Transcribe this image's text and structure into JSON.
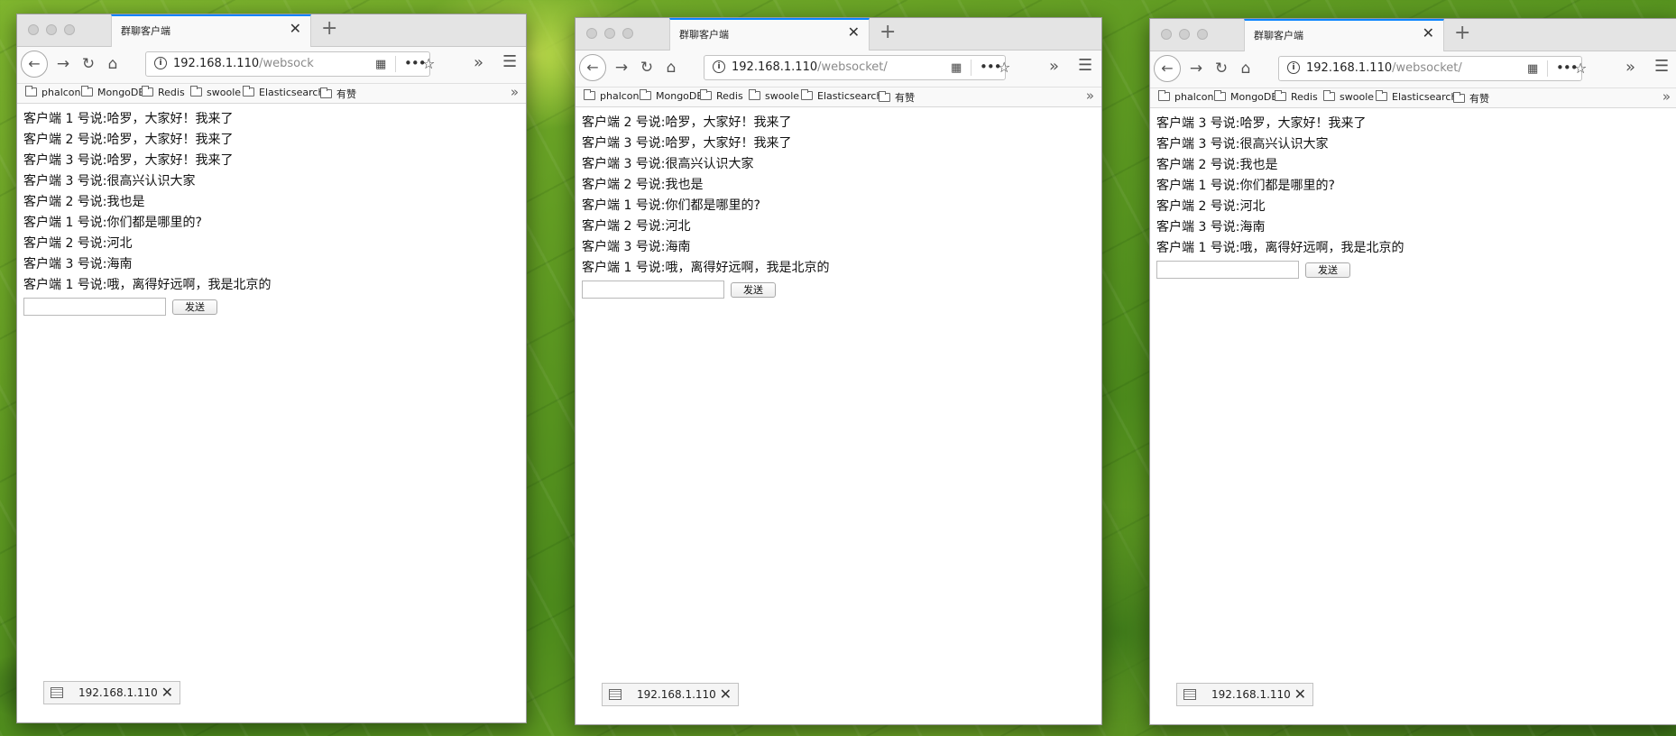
{
  "windows": [
    {
      "tab_title": "群聊客户端",
      "url_main": "192.168.1.110",
      "url_rest": "/websock",
      "bookmarks": [
        "phalcon",
        "MongoDB",
        "Redis",
        "swoole",
        "Elasticsearch",
        "有赞"
      ],
      "messages": [
        "客户端 1 号说:哈罗，大家好！我来了",
        "客户端 2 号说:哈罗，大家好！我来了",
        "客户端 3 号说:哈罗，大家好！我来了",
        "客户端 3 号说:很高兴认识大家",
        "客户端 2 号说:我也是",
        "客户端 1 号说:你们都是哪里的?",
        "客户端 2 号说:河北",
        "客户端 3 号说:海南",
        "客户端 1 号说:哦，离得好远啊，我是北京的"
      ],
      "input_value": "",
      "send_label": "发送",
      "status_text": "192.168.1.110"
    },
    {
      "tab_title": "群聊客户端",
      "url_main": "192.168.1.110",
      "url_rest": "/websocket/",
      "bookmarks": [
        "phalcon",
        "MongoDB",
        "Redis",
        "swoole",
        "Elasticsearch",
        "有赞"
      ],
      "messages": [
        "客户端 2 号说:哈罗，大家好！我来了",
        "客户端 3 号说:哈罗，大家好！我来了",
        "客户端 3 号说:很高兴认识大家",
        "客户端 2 号说:我也是",
        "客户端 1 号说:你们都是哪里的?",
        "客户端 2 号说:河北",
        "客户端 3 号说:海南",
        "客户端 1 号说:哦，离得好远啊，我是北京的"
      ],
      "input_value": "",
      "send_label": "发送",
      "status_text": "192.168.1.110"
    },
    {
      "tab_title": "群聊客户端",
      "url_main": "192.168.1.110",
      "url_rest": "/websocket/",
      "bookmarks": [
        "phalcon",
        "MongoDB",
        "Redis",
        "swoole",
        "Elasticsearch",
        "有赞"
      ],
      "messages": [
        "客户端 3 号说:哈罗，大家好！我来了",
        "客户端 3 号说:很高兴认识大家",
        "客户端 2 号说:我也是",
        "客户端 1 号说:你们都是哪里的?",
        "客户端 2 号说:河北",
        "客户端 3 号说:海南",
        "客户端 1 号说:哦，离得好远啊，我是北京的"
      ],
      "input_value": "",
      "send_label": "发送",
      "status_text": "192.168.1.110"
    }
  ],
  "icons": {
    "back": "back-arrow-icon",
    "forward": "forward-arrow-icon",
    "reload": "reload-icon",
    "home": "home-icon",
    "info": "info-icon",
    "qr": "qr-code-icon",
    "more": "more-actions-icon",
    "star": "bookmark-star-icon",
    "overflow": "overflow-chevron-icon",
    "menu": "hamburger-menu-icon",
    "folder": "folder-icon"
  },
  "colors": {
    "tab_accent": "#0a84ff"
  }
}
